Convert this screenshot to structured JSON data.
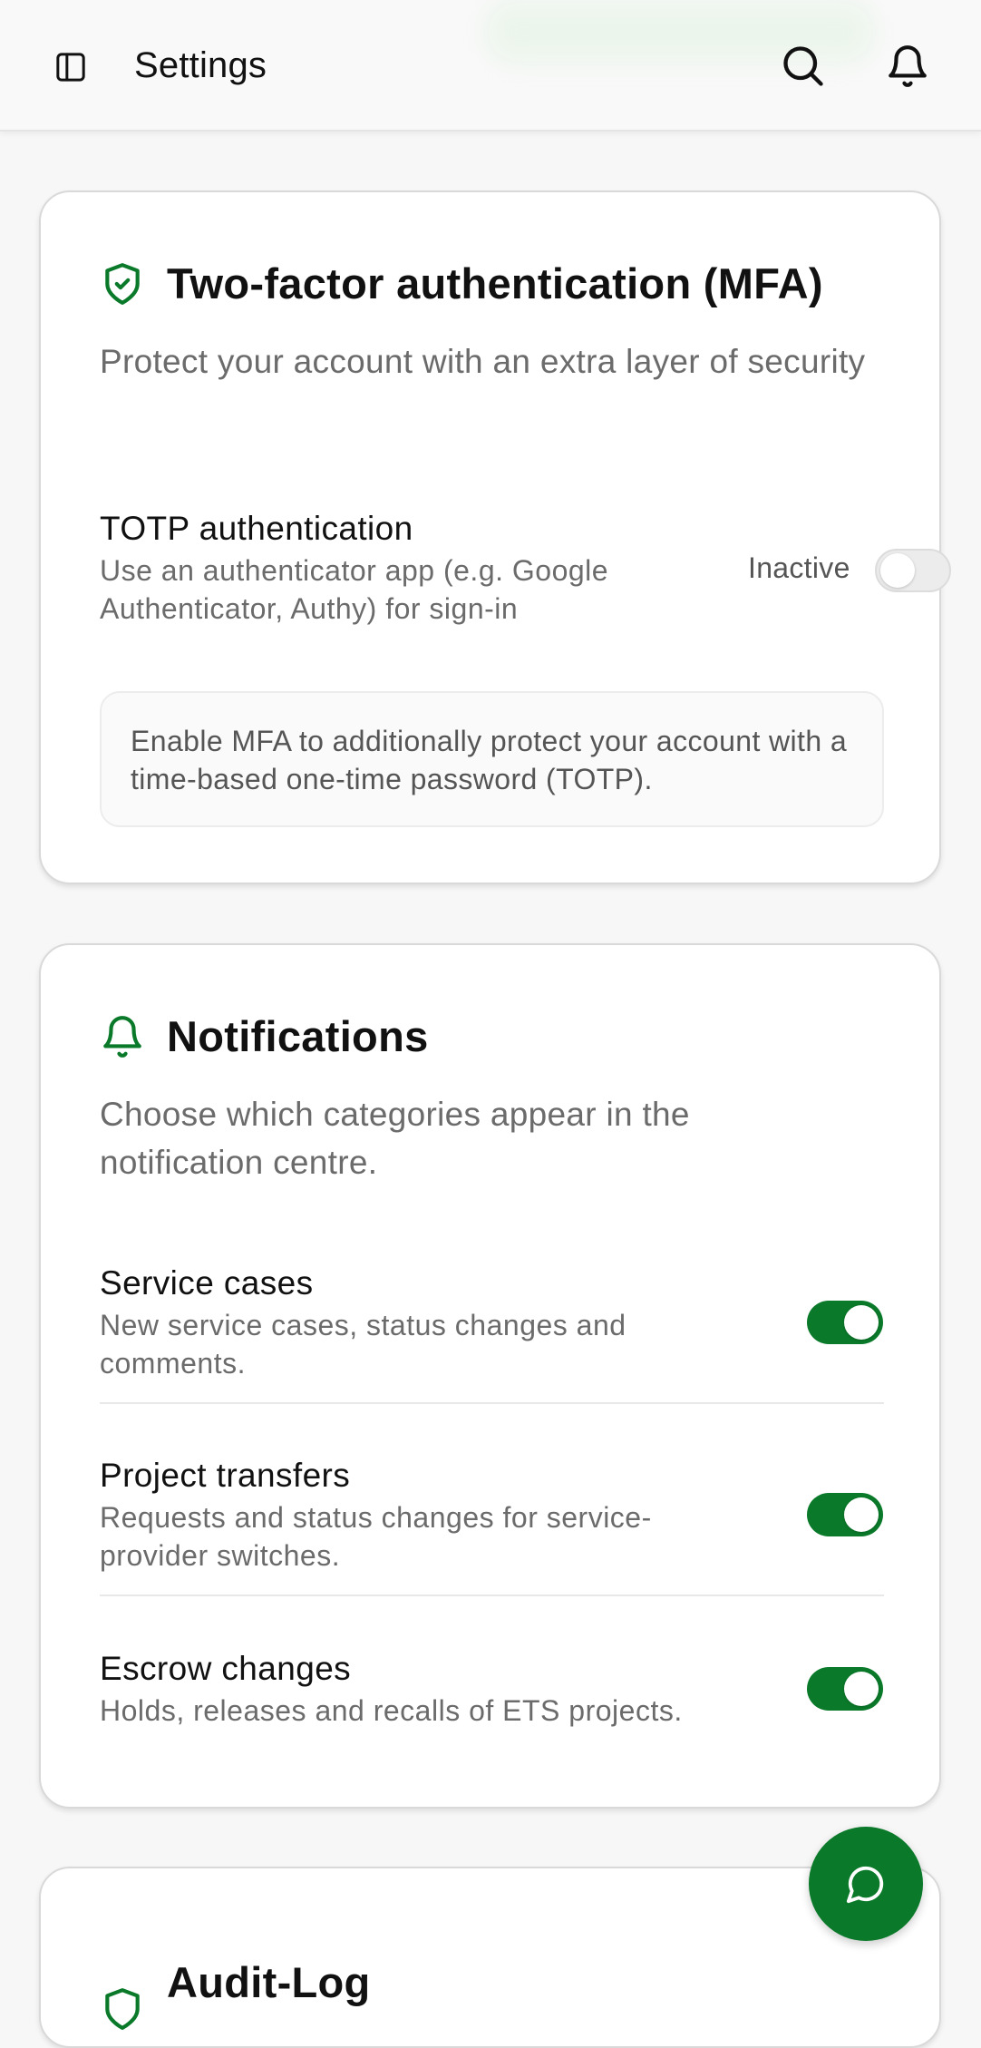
{
  "header": {
    "title": "Settings",
    "icons": [
      "sidebar-toggle-icon",
      "search-icon",
      "bell-icon"
    ]
  },
  "colors": {
    "accent": "#0a7a2a",
    "muted_text": "#6b6b6b",
    "card_border": "#d9d9d9"
  },
  "mfa": {
    "title": "Two-factor authentication (MFA)",
    "description": "Protect your account with an extra layer of security",
    "totp": {
      "title": "TOTP authentication",
      "description": "Use an authenticator app (e.g. Google Authenticator, Authy) for sign-in",
      "status": "Inactive",
      "enabled": false
    },
    "info": "Enable MFA to additionally protect your account with a time-based one-time password (TOTP)."
  },
  "notifications": {
    "title": "Notifications",
    "description": "Choose which categories appear in the notification centre.",
    "items": [
      {
        "title": "Service cases",
        "description": "New service cases, status changes and comments.",
        "enabled": true
      },
      {
        "title": "Project transfers",
        "description": "Requests and status changes for service-provider switches.",
        "enabled": true
      },
      {
        "title": "Escrow changes",
        "description": "Holds, releases and recalls of ETS projects.",
        "enabled": true
      }
    ]
  },
  "audit": {
    "title": "Audit-Log"
  }
}
